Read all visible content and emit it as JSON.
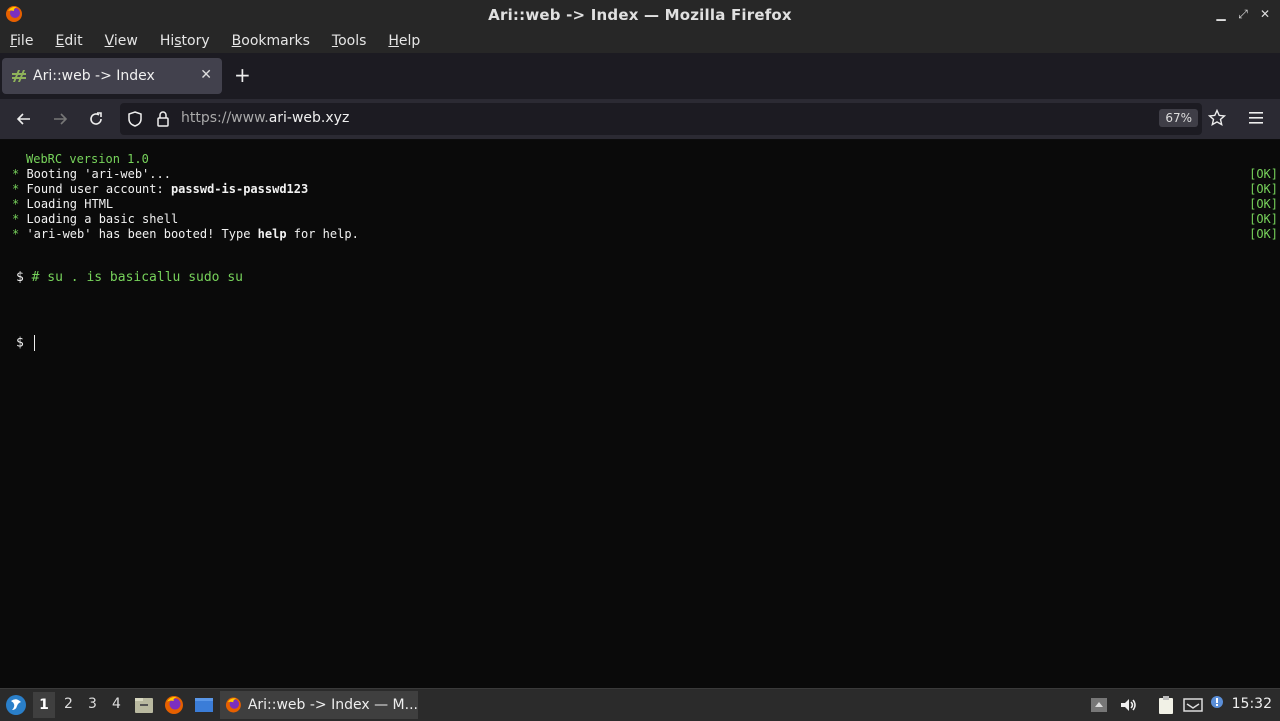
{
  "window": {
    "title": "Ari::web -> Index — Mozilla Firefox"
  },
  "menu": {
    "items": [
      {
        "label": "File",
        "accel": "F",
        "rest": "ile"
      },
      {
        "label": "Edit",
        "accel": "E",
        "rest": "dit"
      },
      {
        "label": "View",
        "accel": "V",
        "rest": "iew"
      },
      {
        "label": "History",
        "pre": "Hi",
        "accel": "s",
        "rest": "tory"
      },
      {
        "label": "Bookmarks",
        "accel": "B",
        "rest": "ookmarks"
      },
      {
        "label": "Tools",
        "accel": "T",
        "rest": "ools"
      },
      {
        "label": "Help",
        "accel": "H",
        "rest": "elp"
      }
    ]
  },
  "tab": {
    "title": "Ari::web -> Index",
    "close": "✕",
    "new_tab": "+"
  },
  "urlbar": {
    "prefix": "https://www.",
    "host": "ari-web.xyz",
    "zoom": "67%"
  },
  "terminal": {
    "version_line": "WebRC version 1.0",
    "boot": [
      {
        "bullet": "*",
        "text": " Booting 'ari-web'...",
        "status": "[OK]"
      },
      {
        "bullet": "*",
        "text": " Found user account: ",
        "bold": "passwd-is-passwd123",
        "status": "[OK]"
      },
      {
        "bullet": "*",
        "text": " Loading HTML",
        "status": "[OK]"
      },
      {
        "bullet": "*",
        "text": " Loading a basic shell",
        "status": "[OK]"
      },
      {
        "bullet": "*",
        "text": " 'ari-web' has been booted! Type ",
        "bold": "help",
        "after": " for help.",
        "status": "[OK]"
      }
    ],
    "prompt1": "$",
    "comment": "# su . is basicallu sudo su",
    "prompt2": "$"
  },
  "taskbar": {
    "workspaces": [
      "1",
      "2",
      "3",
      "4"
    ],
    "task_title": "Ari::web -> Index — M...",
    "clock": "15:32"
  }
}
